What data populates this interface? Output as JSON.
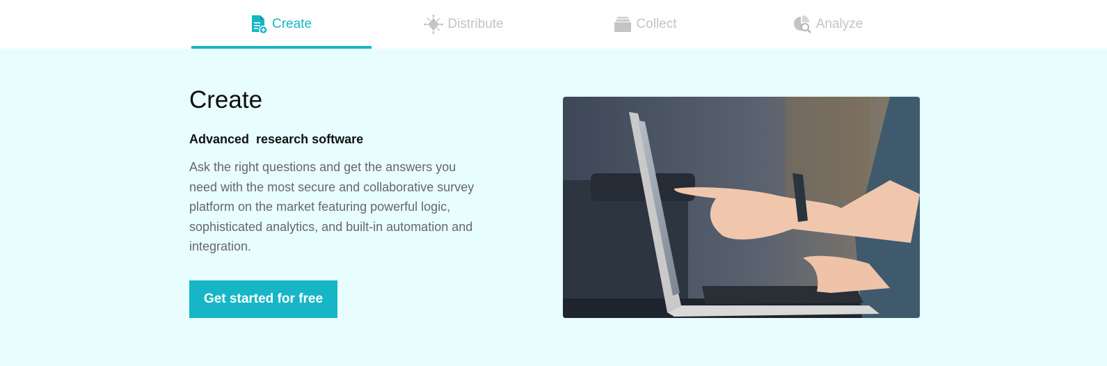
{
  "tabs": [
    {
      "label": "Create",
      "icon": "document-plus-icon",
      "active": true
    },
    {
      "label": "Distribute",
      "icon": "share-network-icon",
      "active": false
    },
    {
      "label": "Collect",
      "icon": "stacked-folders-icon",
      "active": false
    },
    {
      "label": "Analyze",
      "icon": "pie-chart-magnifier-icon",
      "active": false
    }
  ],
  "section": {
    "title": "Create",
    "subtitle": "Advanced  research software",
    "description": "Ask the right questions and get the answers you need with the most secure and collaborative survey platform on the market featuring powerful logic, sophisticated analytics, and built-in automation and integration.",
    "cta_label": "Get started for free"
  },
  "colors": {
    "accent": "#16b6c6",
    "background": "#e8fdfd",
    "inactive_tab": "#c4c4c4"
  }
}
